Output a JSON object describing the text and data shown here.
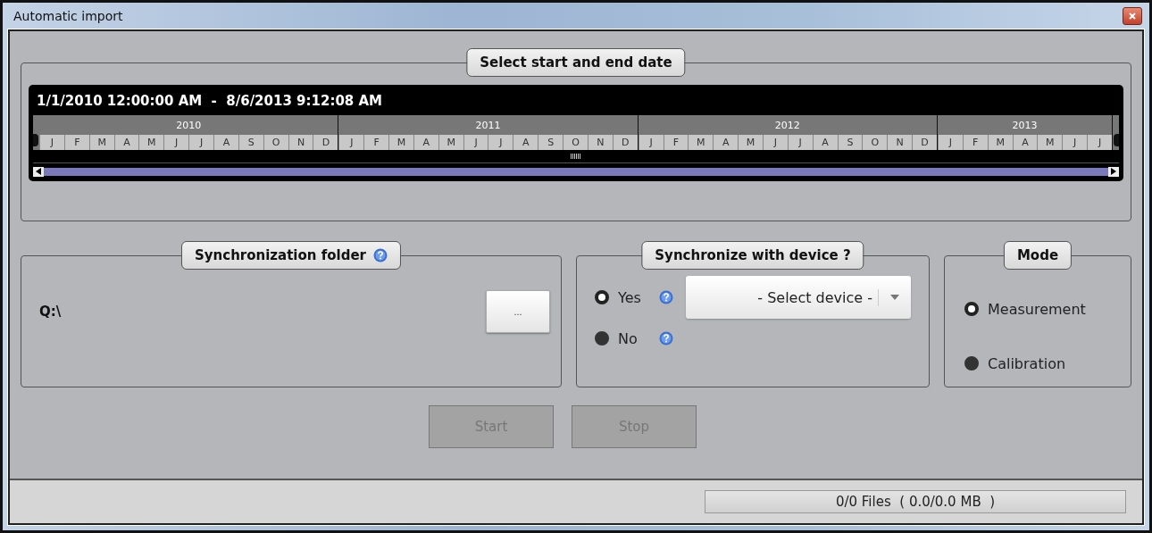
{
  "window": {
    "title": "Automatic import"
  },
  "date_range": {
    "title": "Select start and end date",
    "range": "1/1/2010 12:00:00 AM  -  8/6/2013 9:12:08 AM",
    "years": [
      {
        "label": "2010",
        "months": [
          "J",
          "F",
          "M",
          "A",
          "M",
          "J",
          "J",
          "A",
          "S",
          "O",
          "N",
          "D"
        ]
      },
      {
        "label": "2011",
        "months": [
          "J",
          "F",
          "M",
          "A",
          "M",
          "J",
          "J",
          "A",
          "S",
          "O",
          "N",
          "D"
        ]
      },
      {
        "label": "2012",
        "months": [
          "J",
          "F",
          "M",
          "A",
          "M",
          "J",
          "J",
          "A",
          "S",
          "O",
          "N",
          "D"
        ]
      },
      {
        "label": "2013",
        "months": [
          "J",
          "F",
          "M",
          "A",
          "M",
          "J",
          "J"
        ]
      }
    ]
  },
  "sync_folder": {
    "title": "Synchronization folder",
    "path": "Q:\\",
    "browse_button": "..."
  },
  "sync_device": {
    "title": "Synchronize with device ?",
    "options": [
      {
        "label": "Yes",
        "selected": true
      },
      {
        "label": "No",
        "selected": false
      }
    ],
    "device_select": "- Select device -"
  },
  "mode": {
    "title": "Mode",
    "options": [
      {
        "label": "Measurement",
        "selected": true
      },
      {
        "label": "Calibration",
        "selected": false
      }
    ]
  },
  "buttons": [
    {
      "label": "Start",
      "disabled": true
    },
    {
      "label": "Stop",
      "disabled": true
    }
  ],
  "status_bar": {
    "progress": {
      "text": "0/0 Files  ( 0.0/0.0 MB  )"
    }
  }
}
